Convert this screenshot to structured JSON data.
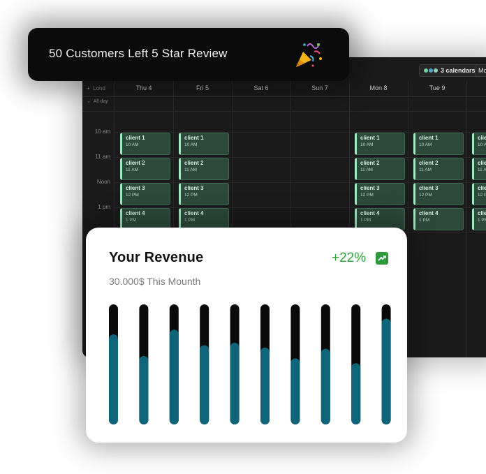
{
  "notification": {
    "text": "50 Customers Left 5 Star Review",
    "icon": "party-popper-icon"
  },
  "calendar": {
    "calendars_label": "3 calendars",
    "view_label": "Mo",
    "timezone_label": "Lond",
    "allday_label": "All day",
    "days": [
      "Thu  4",
      "Fri  5",
      "Sat  6",
      "Sun  7",
      "Mon  8",
      "Tue  9"
    ],
    "times": [
      "10 am",
      "11 am",
      "Noon",
      "1 pm"
    ],
    "events": [
      {
        "title": "client 1",
        "time": "10 AM"
      },
      {
        "title": "client 2",
        "time": "11 AM"
      },
      {
        "title": "client 3",
        "time": "12 PM"
      },
      {
        "title": "client 4",
        "time": "1 PM"
      }
    ],
    "accent": "#a6e8c2"
  },
  "revenue": {
    "title": "Your Revenue",
    "subtitle": "30.000$ This Mounth",
    "change": "+22%",
    "change_color": "#2fa33a",
    "icon": "trend-up-icon"
  },
  "chart_data": {
    "type": "bar",
    "values": [
      0.75,
      0.57,
      0.79,
      0.66,
      0.68,
      0.64,
      0.55,
      0.63,
      0.51,
      0.88
    ],
    "max": 1.0,
    "fill_color": "#0e6478",
    "track_color": "#0a0a0a"
  }
}
